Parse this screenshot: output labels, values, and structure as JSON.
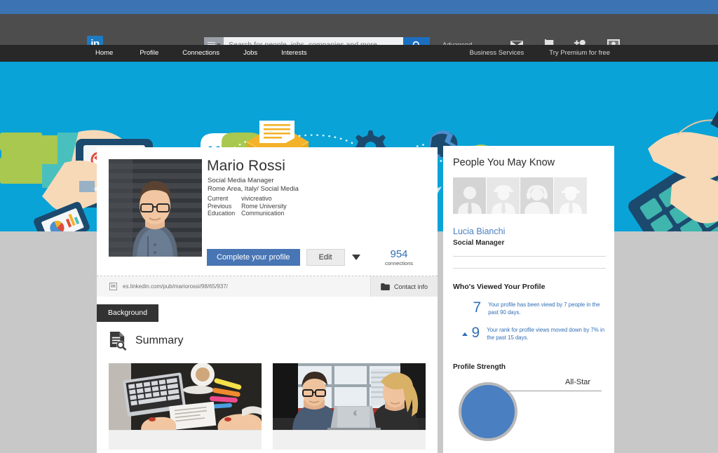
{
  "header": {
    "logo_text": "in",
    "logo_name": "linkedin-logo",
    "search_placeholder": "Search for people, jobs, companies and more...",
    "search_value": "",
    "search_button_icon": "search-icon",
    "advanced_label": "Advanced",
    "icons": [
      {
        "name": "messages-icon",
        "glyph": "envelope"
      },
      {
        "name": "notifications-flag-icon",
        "glyph": "flag"
      },
      {
        "name": "add-connection-icon",
        "glyph": "person-plus"
      },
      {
        "name": "account-avatar-icon",
        "glyph": "avatar-frame"
      }
    ]
  },
  "nav": {
    "left_items": [
      {
        "label": "Home",
        "name": "nav-item-home"
      },
      {
        "label": "Profile",
        "name": "nav-item-profile"
      },
      {
        "label": "Connections",
        "name": "nav-item-connections"
      },
      {
        "label": "Jobs",
        "name": "nav-item-jobs"
      },
      {
        "label": "Interests",
        "name": "nav-item-interests"
      }
    ],
    "right_items": [
      {
        "label": "Business Services",
        "name": "nav-item-business-services"
      },
      {
        "label": "Try Premium for free",
        "name": "nav-item-try-premium"
      }
    ]
  },
  "profile": {
    "name": "Mario Rossi",
    "headline_line1": "Social Media Manager",
    "headline_line2": "Rome Area, Italy/ Social Media",
    "meta": [
      {
        "key": "Current",
        "value": "vivicreativo"
      },
      {
        "key": "Previous",
        "value": "Rome University"
      },
      {
        "key": "Education",
        "value": "Communication"
      }
    ],
    "primary_button": "Complete your profile",
    "edit_button": "Edit",
    "connections_count": "954",
    "connections_label": "connections",
    "public_url": "es.linkedin.com/pub/mariorossi/98/65/937/",
    "contact_info_label": "Contact info",
    "background_tab": "Background",
    "summary_title": "Summary"
  },
  "sidebar": {
    "pymk_title": "People You May Know",
    "avatars": [
      {
        "name": "avatar-person-tie",
        "glyph": "tie"
      },
      {
        "name": "avatar-person-hardhat",
        "glyph": "hardhat"
      },
      {
        "name": "avatar-person-headset",
        "glyph": "headset"
      },
      {
        "name": "avatar-person-cap",
        "glyph": "cap"
      }
    ],
    "pymk_person_name": "Lucia Bianchi",
    "pymk_person_role": "Social Manager",
    "viewed_title": "Who's Viewed Your Profile",
    "stats": [
      {
        "number": "7",
        "arrow": "none",
        "text": "Your profile has been viewd by 7 people in the past 90 days.",
        "name": "stat-profile-views"
      },
      {
        "number": "9",
        "arrow": "up",
        "text": "Your rank for profile views moved down by 7% in the past 15 days.",
        "name": "stat-profile-rank"
      }
    ],
    "profile_strength_title": "Profile Strength",
    "profile_strength_level": "All-Star"
  },
  "colors": {
    "top_strip": "#3b73b3",
    "header_gray": "#4d4d4d",
    "nav_dark": "#282828",
    "banner_cyan": "#0aa3d7",
    "accent_blue": "#4875b4",
    "link_blue": "#2f6eb5",
    "page_gray": "#c8c8c8"
  }
}
